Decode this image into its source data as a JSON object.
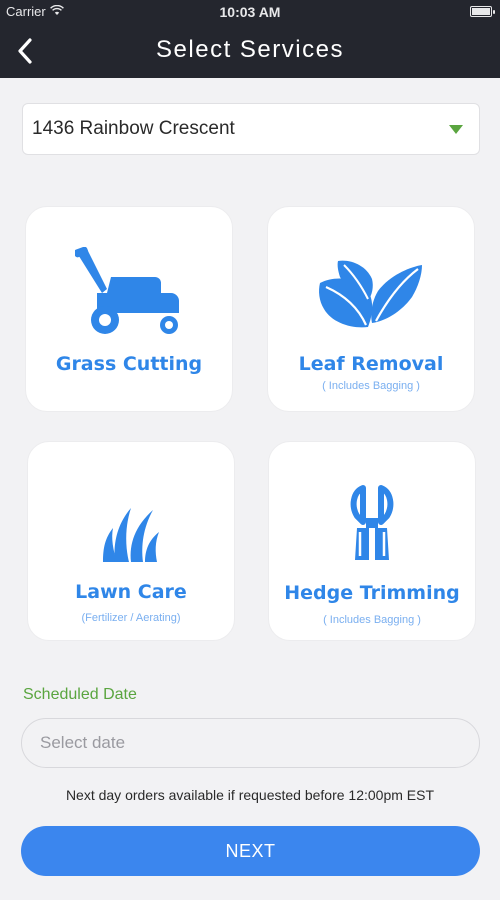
{
  "status_bar": {
    "carrier": "Carrier",
    "time": "10:03 AM"
  },
  "nav": {
    "title": "Select Services",
    "back_icon": "chevron-left-icon"
  },
  "address": {
    "value": "1436 Rainbow Crescent",
    "caret_color": "#5aa53f"
  },
  "services": [
    {
      "label": "Grass Cutting",
      "sub": "",
      "icon": "lawn-mower-icon"
    },
    {
      "label": "Leaf Removal",
      "sub": "( Includes Bagging )",
      "icon": "leaves-icon"
    },
    {
      "label": "Lawn Care",
      "sub": "(Fertilizer / Aerating)",
      "icon": "grass-icon"
    },
    {
      "label": "Hedge Trimming",
      "sub": "( Includes Bagging )",
      "icon": "hedge-shears-icon"
    }
  ],
  "schedule": {
    "label": "Scheduled Date",
    "placeholder": "Select date",
    "note": "Next day orders available if requested before 12:00pm EST"
  },
  "next_button": {
    "label": "NEXT"
  },
  "colors": {
    "header_bg": "#24262e",
    "accent_blue": "#3b86ee",
    "icon_blue": "#2f86e8",
    "accent_green": "#5aa53f"
  }
}
